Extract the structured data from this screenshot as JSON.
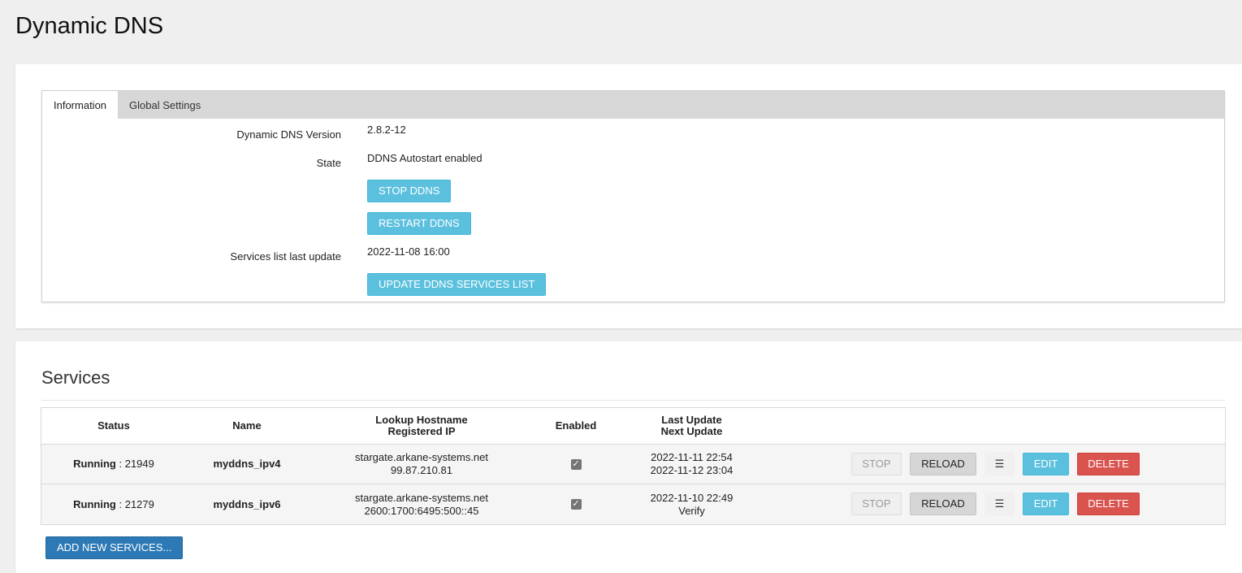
{
  "page": {
    "title": "Dynamic DNS"
  },
  "tabs": [
    {
      "label": "Information",
      "active": true
    },
    {
      "label": "Global Settings",
      "active": false
    }
  ],
  "info": {
    "version_label": "Dynamic DNS Version",
    "version_value": "2.8.2-12",
    "state_label": "State",
    "state_value": "DDNS Autostart enabled",
    "stop_button": "STOP DDNS",
    "restart_button": "RESTART DDNS",
    "services_update_label": "Services list last update",
    "services_update_value": "2022-11-08 16:00",
    "update_list_button": "UPDATE DDNS SERVICES LIST"
  },
  "services": {
    "title": "Services",
    "columns": {
      "status": "Status",
      "name": "Name",
      "lookup_hostname": "Lookup Hostname",
      "registered_ip": "Registered IP",
      "enabled": "Enabled",
      "last_update": "Last Update",
      "next_update": "Next Update"
    },
    "rows": [
      {
        "status": "Running",
        "pid": ": 21949",
        "name": "myddns_ipv4",
        "hostname": "stargate.arkane-systems.net",
        "ip": "99.87.210.81",
        "enabled": true,
        "last_update": "2022-11-11 22:54",
        "next_update": "2022-11-12 23:04"
      },
      {
        "status": "Running",
        "pid": ": 21279",
        "name": "myddns_ipv6",
        "hostname": "stargate.arkane-systems.net",
        "ip": "2600:1700:6495:500::45",
        "enabled": true,
        "last_update": "2022-11-10 22:49",
        "next_update": "Verify"
      }
    ],
    "row_actions": {
      "stop": "STOP",
      "reload": "RELOAD",
      "menu": "☰",
      "edit": "EDIT",
      "delete": "DELETE"
    },
    "add_button": "ADD NEW SERVICES..."
  },
  "colors": {
    "info_button": "#5bc0de",
    "primary_button": "#2c79b5",
    "danger_button": "#d9534f",
    "tabbar": "#d7d7d7",
    "page_background": "#efefef"
  }
}
